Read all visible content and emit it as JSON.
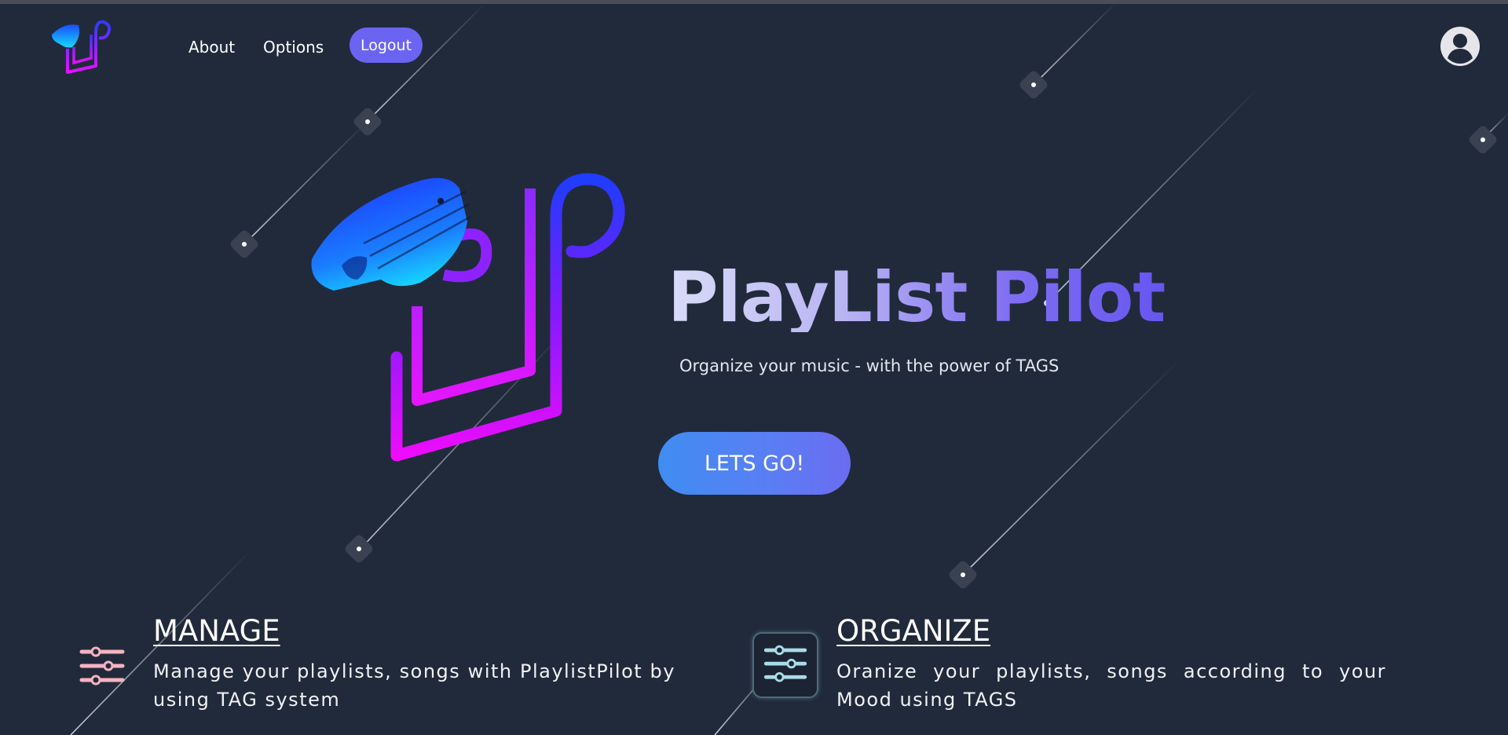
{
  "nav": {
    "logo_icon": "playlist-pilot-logo",
    "about_label": "About",
    "options_label": "Options",
    "logout_label": "Logout",
    "user_icon": "user-circle-icon"
  },
  "hero": {
    "title": "PlayList Pilot",
    "subtitle": "Organize your music - with the power of TAGS",
    "cta_label": "LETS GO!"
  },
  "features": [
    {
      "icon": "sliders-icon",
      "title": "MANAGE",
      "description": "Manage your playlists, songs with PlaylistPilot by using TAG system",
      "icon_color": "#f6b3c3"
    },
    {
      "icon": "sliders-icon",
      "title": "ORGANIZE",
      "description": "Oranize your playlists, songs according to your Mood using TAGS",
      "icon_color": "#a9dbe8"
    }
  ],
  "colors": {
    "background": "#212a3b",
    "accent": "#6b64f2",
    "cta_start": "#3f8df2",
    "logo_blue": "#1a4cff",
    "logo_magenta": "#e312ff"
  }
}
